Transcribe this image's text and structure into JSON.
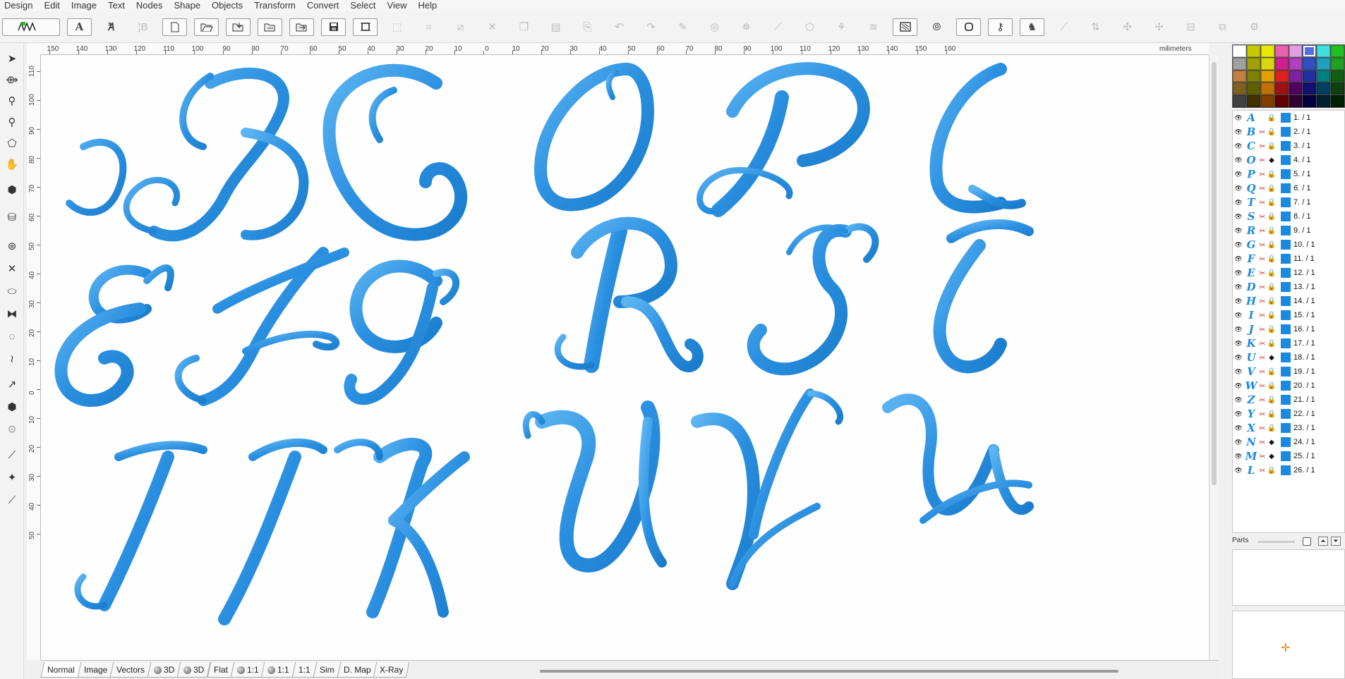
{
  "menu": [
    "Design",
    "Edit",
    "Image",
    "Text",
    "Nodes",
    "Shape",
    "Objects",
    "Transform",
    "Convert",
    "Select",
    "View",
    "Help"
  ],
  "ruler": {
    "unit_label": "milimeters",
    "h_ticks": [
      "150",
      "140",
      "130",
      "120",
      "110",
      "100",
      "90",
      "80",
      "70",
      "60",
      "50",
      "40",
      "30",
      "20",
      "10",
      "0",
      "10",
      "20",
      "30",
      "40",
      "50",
      "60",
      "70",
      "80",
      "90",
      "100",
      "110",
      "120",
      "130",
      "140",
      "150",
      "160"
    ],
    "v_ticks": [
      "110",
      "100",
      "90",
      "80",
      "70",
      "60",
      "50",
      "40",
      "30",
      "20",
      "10",
      "0",
      "10",
      "20",
      "30",
      "40",
      "50"
    ]
  },
  "canvas": {
    "thread_color": "#2a8fe0",
    "thread_highlight": "#5cb4f2",
    "letters": [
      "B",
      "C",
      "O",
      "P",
      "Q",
      "E",
      "F",
      "G",
      "R",
      "S",
      "T",
      "I",
      "J",
      "K",
      "U",
      "V",
      "W"
    ]
  },
  "tabs": [
    {
      "label": "Normal",
      "dot": false
    },
    {
      "label": "Image",
      "dot": false
    },
    {
      "label": "Vectors",
      "dot": false
    },
    {
      "label": "3D",
      "dot": true
    },
    {
      "label": "3D",
      "dot": true
    },
    {
      "label": "Flat",
      "dot": false
    },
    {
      "label": "1:1",
      "dot": true
    },
    {
      "label": "1:1",
      "dot": true
    },
    {
      "label": "1:1",
      "dot": false
    },
    {
      "label": "Sim",
      "dot": false
    },
    {
      "label": "D. Map",
      "dot": false
    },
    {
      "label": "X-Ray",
      "dot": false
    }
  ],
  "palette": [
    "#ffffff",
    "#c8c800",
    "#e8e800",
    "#e860b0",
    "#e0a0e0",
    "#5070e0",
    "#40e0e0",
    "#20c020",
    "#a0a0a0",
    "#a0a000",
    "#d8d800",
    "#d02090",
    "#b040c0",
    "#3050c0",
    "#20a0c0",
    "#20a020",
    "#c08040",
    "#808000",
    "#e0a000",
    "#e02020",
    "#8020a0",
    "#2030a0",
    "#008080",
    "#106010",
    "#806020",
    "#606000",
    "#c07000",
    "#a01010",
    "#500060",
    "#101070",
    "#004060",
    "#104010",
    "#404040",
    "#403000",
    "#804000",
    "#600000",
    "#300030",
    "#000040",
    "#002030",
    "#002000"
  ],
  "palette_selected": 5,
  "layers": [
    {
      "glyph": "A",
      "label": "1.  / 1",
      "needle": false,
      "lock": "lock"
    },
    {
      "glyph": "B",
      "label": "2.  / 1",
      "needle": true,
      "lock": "lock"
    },
    {
      "glyph": "C",
      "label": "3.  / 1",
      "needle": true,
      "lock": "lock"
    },
    {
      "glyph": "O",
      "label": "4.  / 1",
      "needle": true,
      "lock": "tag"
    },
    {
      "glyph": "P",
      "label": "5.  / 1",
      "needle": true,
      "lock": "lock"
    },
    {
      "glyph": "Q",
      "label": "6.  / 1",
      "needle": true,
      "lock": "lock"
    },
    {
      "glyph": "T",
      "label": "7.  / 1",
      "needle": true,
      "lock": "lock"
    },
    {
      "glyph": "S",
      "label": "8.  / 1",
      "needle": true,
      "lock": "lock"
    },
    {
      "glyph": "R",
      "label": "9.  / 1",
      "needle": true,
      "lock": "lockp"
    },
    {
      "glyph": "G",
      "label": "10.  / 1",
      "needle": true,
      "lock": "lock"
    },
    {
      "glyph": "F",
      "label": "11.  / 1",
      "needle": true,
      "lock": "lock"
    },
    {
      "glyph": "E",
      "label": "12.  / 1",
      "needle": true,
      "lock": "lock"
    },
    {
      "glyph": "D",
      "label": "13.  / 1",
      "needle": true,
      "lock": "lockp"
    },
    {
      "glyph": "H",
      "label": "14.  / 1",
      "needle": true,
      "lock": "lockp"
    },
    {
      "glyph": "I",
      "label": "15.  / 1",
      "needle": true,
      "lock": "lock"
    },
    {
      "glyph": "J",
      "label": "16.  / 1",
      "needle": true,
      "lock": "lockp"
    },
    {
      "glyph": "K",
      "label": "17.  / 1",
      "needle": true,
      "lock": "lockp"
    },
    {
      "glyph": "U",
      "label": "18.  / 1",
      "needle": true,
      "lock": "tag"
    },
    {
      "glyph": "V",
      "label": "19.  / 1",
      "needle": true,
      "lock": "lock"
    },
    {
      "glyph": "W",
      "label": "20.  / 1",
      "needle": true,
      "lock": "lockp"
    },
    {
      "glyph": "Z",
      "label": "21.  / 1",
      "needle": true,
      "lock": "lock"
    },
    {
      "glyph": "Y",
      "label": "22.  / 1",
      "needle": true,
      "lock": "lock"
    },
    {
      "glyph": "X",
      "label": "23.  / 1",
      "needle": true,
      "lock": "lockp"
    },
    {
      "glyph": "N",
      "label": "24.  / 1",
      "needle": true,
      "lock": "tag"
    },
    {
      "glyph": "M",
      "label": "25.  / 1",
      "needle": true,
      "lock": "tag"
    },
    {
      "glyph": "L",
      "label": "26.  / 1",
      "needle": true,
      "lock": "lock"
    }
  ],
  "parts": {
    "label": "Parts"
  }
}
